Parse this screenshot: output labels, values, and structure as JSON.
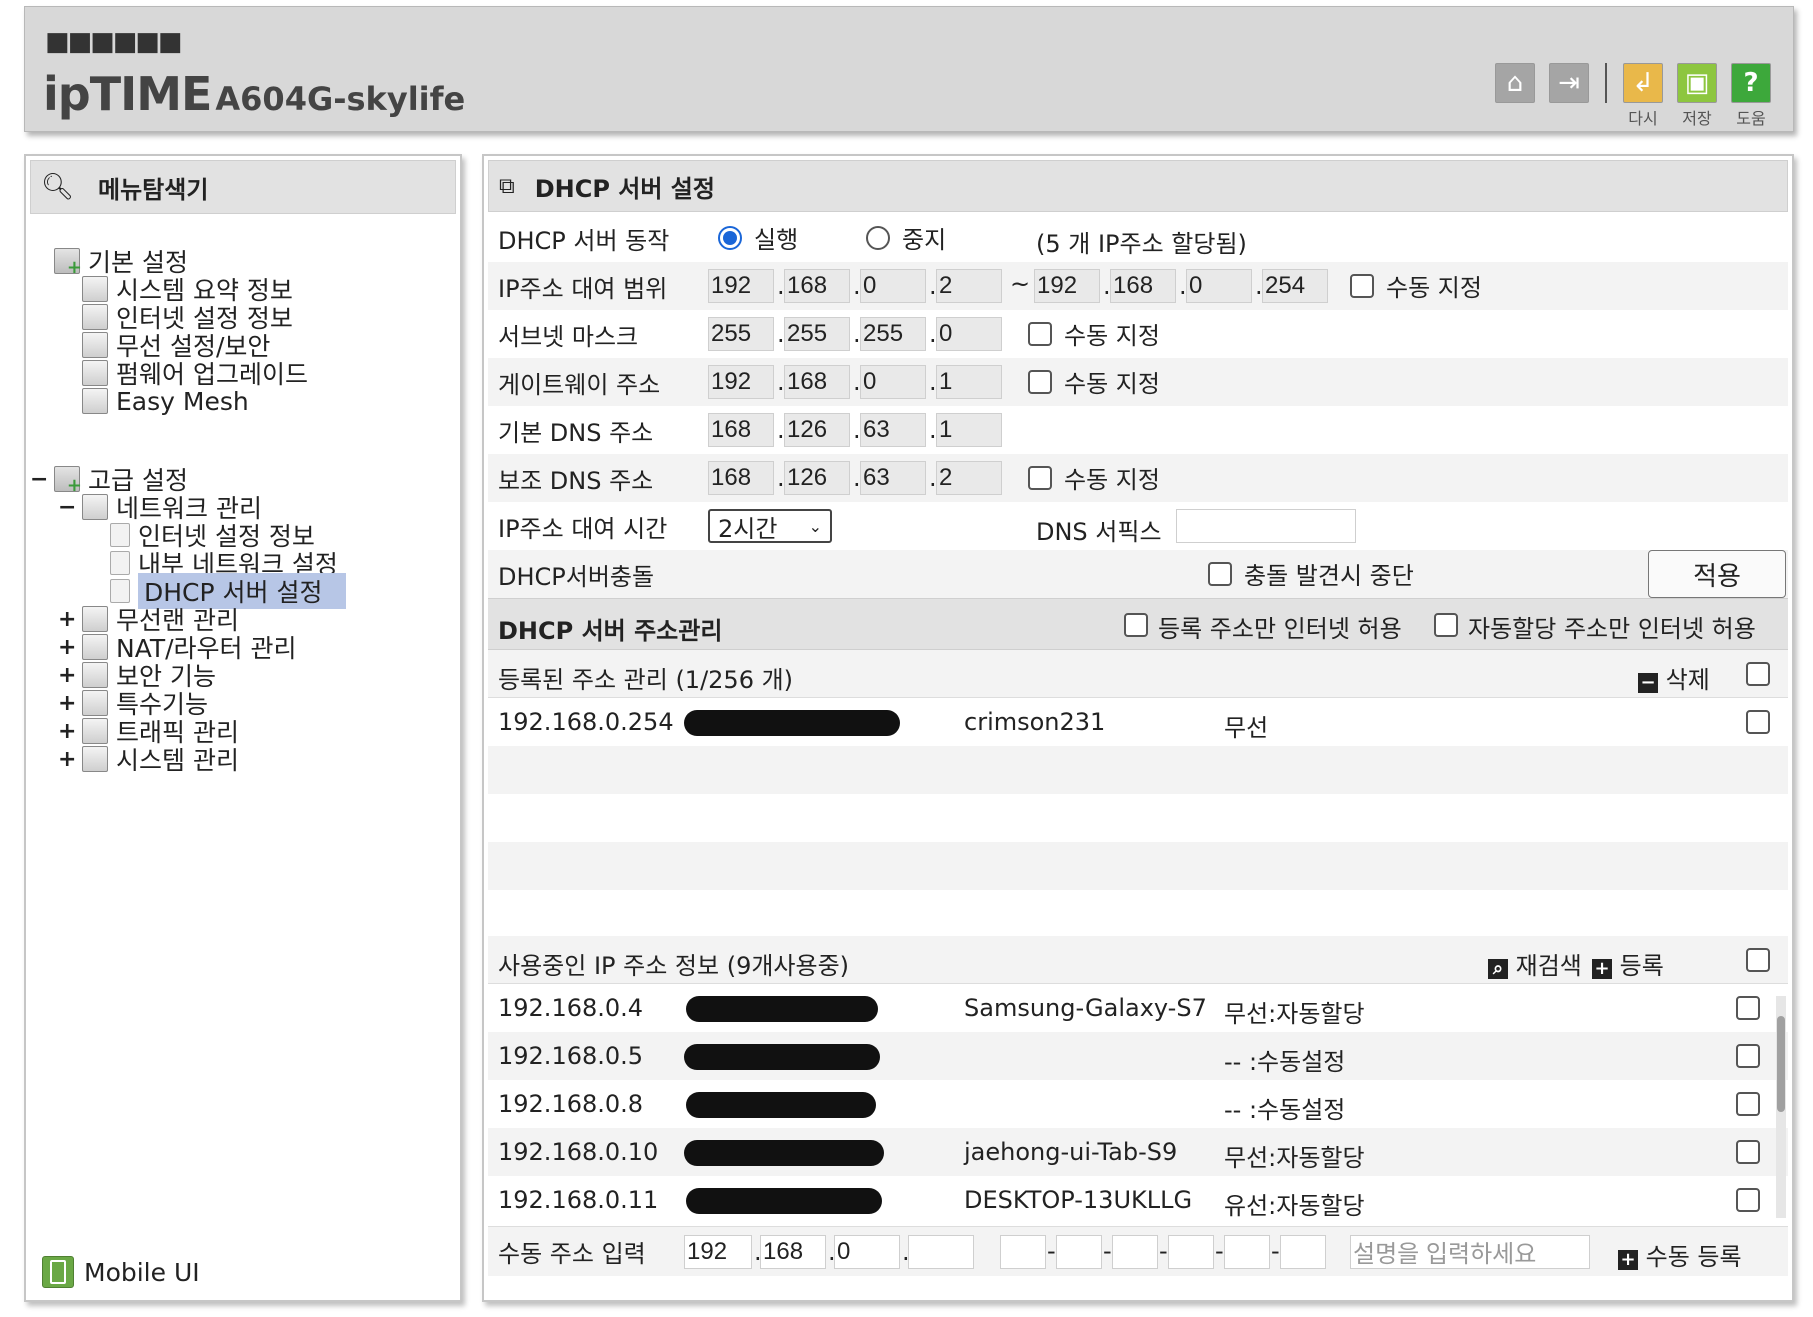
{
  "header": {
    "brand_dots": "■■■■■■",
    "logo": "ipTIME",
    "model": "A604G-skylife",
    "buttons": [
      {
        "name": "home",
        "label": ""
      },
      {
        "name": "logout",
        "label": ""
      },
      {
        "name": "restart",
        "label": "다시"
      },
      {
        "name": "save",
        "label": "저장"
      },
      {
        "name": "help",
        "label": "도움"
      }
    ]
  },
  "sidebar": {
    "title": "메뉴탐색기",
    "basic": {
      "label": "기본 설정",
      "items": [
        "시스템 요약 정보",
        "인터넷 설정 정보",
        "무선 설정/보안",
        "펌웨어 업그레이드",
        "Easy Mesh"
      ]
    },
    "advanced": {
      "label": "고급 설정",
      "network": {
        "label": "네트워크 관리",
        "items": [
          "인터넷 설정 정보",
          "내부 네트워크 설정",
          "DHCP 서버 설정"
        ]
      },
      "items": [
        "무선랜 관리",
        "NAT/라우터 관리",
        "보안 기능",
        "특수기능",
        "트래픽 관리",
        "시스템 관리"
      ]
    },
    "mobile_label": "Mobile UI"
  },
  "main": {
    "title": "DHCP 서버 설정",
    "dhcp_action": {
      "label": "DHCP 서버 동작",
      "run": "실행",
      "stop": "중지",
      "assigned_note": "(5 개 IP주소 할당됨)"
    },
    "range": {
      "label": "IP주소 대여 범위",
      "start": [
        "192",
        "168",
        "0",
        "2"
      ],
      "end": [
        "192",
        "168",
        "0",
        "254"
      ],
      "tilde": "~",
      "manual": "수동 지정"
    },
    "subnet": {
      "label": "서브넷 마스크",
      "octets": [
        "255",
        "255",
        "255",
        "0"
      ],
      "manual": "수동 지정"
    },
    "gateway": {
      "label": "게이트웨이 주소",
      "octets": [
        "192",
        "168",
        "0",
        "1"
      ],
      "manual": "수동 지정"
    },
    "dns1": {
      "label": "기본 DNS 주소",
      "octets": [
        "168",
        "126",
        "63",
        "1"
      ]
    },
    "dns2": {
      "label": "보조 DNS 주소",
      "octets": [
        "168",
        "126",
        "63",
        "2"
      ],
      "manual": "수동 지정"
    },
    "lease": {
      "label": "IP주소 대여 시간",
      "value": "2시간",
      "dns_suffix_label": "DNS 서픽스",
      "dns_suffix_value": ""
    },
    "conflict": {
      "label": "DHCP서버충돌",
      "stop_on_conflict": "충돌 발견시 중단",
      "apply": "적용"
    },
    "addr_mgmt": {
      "title": "DHCP 서버 주소관리",
      "only_registered": "등록 주소만 인터넷 허용",
      "only_auto": "자동할당 주소만 인터넷 허용"
    },
    "registered": {
      "header": "등록된 주소 관리 (1/256 개)",
      "delete": "삭제",
      "rows": [
        {
          "ip": "192.168.0.254",
          "name": "crimson231",
          "type": "무선"
        }
      ]
    },
    "in_use": {
      "header": "사용중인 IP 주소 정보 (9개사용중)",
      "rescan": "재검색",
      "register": "등록",
      "rows": [
        {
          "ip": "192.168.0.4",
          "name": "Samsung-Galaxy-S7",
          "type": "무선:자동할당"
        },
        {
          "ip": "192.168.0.5",
          "name": "",
          "type": "-- :수동설정"
        },
        {
          "ip": "192.168.0.8",
          "name": "",
          "type": "-- :수동설정"
        },
        {
          "ip": "192.168.0.10",
          "name": "jaehong-ui-Tab-S9",
          "type": "무선:자동할당"
        },
        {
          "ip": "192.168.0.11",
          "name": "DESKTOP-13UKLLG",
          "type": "유선:자동할당"
        }
      ]
    },
    "manual_entry": {
      "label": "수동 주소 입력",
      "octets": [
        "192",
        "168",
        "0",
        ""
      ],
      "mac_sep": "-",
      "desc_placeholder": "설명을 입력하세요",
      "register": "수동 등록"
    }
  }
}
